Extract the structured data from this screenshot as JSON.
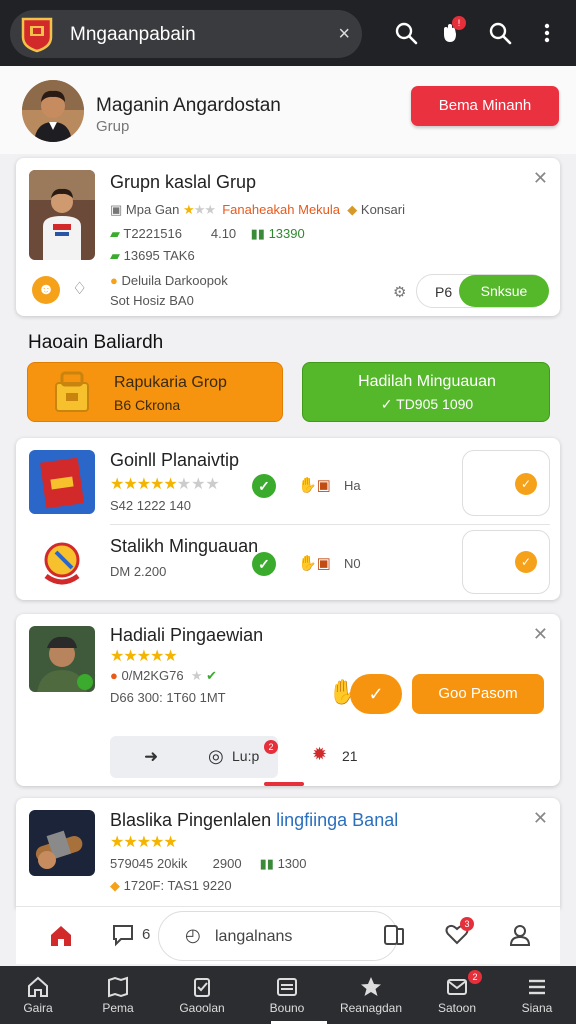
{
  "topbar": {
    "app_title": "Mngaanpabain",
    "close_glyph": "×",
    "notif_badge": "!",
    "icons": [
      "search-icon",
      "hand-icon",
      "search-icon",
      "more-vertical-icon"
    ]
  },
  "profile": {
    "name": "Maganin Angardostan",
    "sub": "Grup",
    "button": "Bema Minanh"
  },
  "card1": {
    "title": "Grupn kaslal Grup",
    "meta1_a": "Mpa Gan",
    "meta1_b": "Fanaheakah Mekula",
    "meta1_c": "Konsari",
    "meta2_a": "T2221516",
    "meta2_b": "4.10",
    "meta2_c": "13390",
    "meta3": "13695 TAK6",
    "foot1": "Deluila Darkoopok",
    "foot2": "Sot Hosiz BA0",
    "pill_value": "P6",
    "pill_button": "Snksue"
  },
  "section": {
    "title": "Haoain Baliardh",
    "left_btn_line1": "Rapukaria Grop",
    "left_btn_line2": "B6 Ckrona",
    "right_btn_line1": "Hadilah Minguauan",
    "right_btn_line2": "✓ TD905 1090"
  },
  "list": {
    "items": [
      {
        "title": "Goinll Planaivtip",
        "meta": "S42 1222 140",
        "tag": "Ha"
      },
      {
        "title": "Stalikh Minguauan",
        "meta": "DM 2.200",
        "tag": "N0"
      }
    ]
  },
  "card2": {
    "title": "Hadiali Pingaewian",
    "meta1": "0/M2KG76",
    "meta2": "D66 300: 1T60 1MT",
    "button": "Goo Pasom",
    "chip_label": "Lu:p",
    "chip_badge": "2",
    "count": "21"
  },
  "card3": {
    "title_black": "Blaslika Pingenlalen",
    "title_blue": "lingfiinga Banal",
    "meta1_a": "579045 20kik",
    "meta1_b": "2900",
    "meta1_c": "1300",
    "meta2": "1720F: TAS1 9220"
  },
  "action_bar": {
    "count": "6",
    "search_text": "langalnans",
    "heart_badge": "3"
  },
  "bottom_nav": {
    "items": [
      "Gaira",
      "Pema",
      "Gaoolan",
      "Bouno",
      "Reanagdan",
      "Satoon",
      "Siana"
    ],
    "badge": "2"
  }
}
